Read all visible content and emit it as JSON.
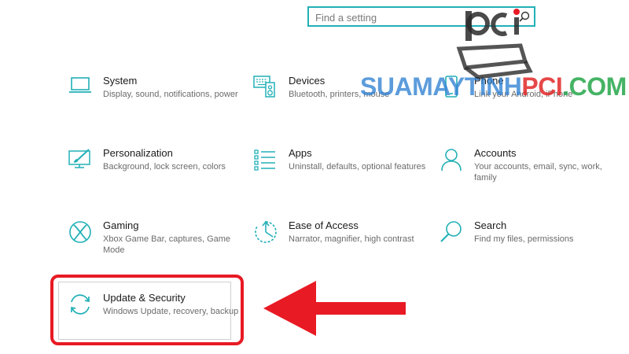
{
  "search": {
    "placeholder": "Find a setting"
  },
  "tiles": [
    {
      "title": "System",
      "desc": "Display, sound, notifications, power",
      "icon": "laptop-icon"
    },
    {
      "title": "Devices",
      "desc": "Bluetooth, printers, mouse",
      "icon": "keyboard-speaker-icon"
    },
    {
      "title": "Phone",
      "desc": "Link your Android, iPhone",
      "icon": "phone-icon"
    },
    {
      "title": "Personalization",
      "desc": "Background, lock screen, colors",
      "icon": "paint-brush-icon"
    },
    {
      "title": "Apps",
      "desc": "Uninstall, defaults, optional features",
      "icon": "apps-list-icon"
    },
    {
      "title": "Accounts",
      "desc": "Your accounts, email, sync, work, family",
      "icon": "person-icon"
    },
    {
      "title": "Gaming",
      "desc": "Xbox Game Bar, captures, Game Mode",
      "icon": "xbox-icon"
    },
    {
      "title": "Ease of Access",
      "desc": "Narrator, magnifier, high contrast",
      "icon": "ease-of-access-icon"
    },
    {
      "title": "Search",
      "desc": "Find my files, permissions",
      "icon": "search-icon"
    },
    {
      "title": "Update & Security",
      "desc": "Windows Update, recovery, backup",
      "icon": "sync-arrows-icon"
    }
  ],
  "watermark": {
    "main": "SUAMAYTINH",
    "pci": "PCI",
    "dot": ".",
    "com": "COM"
  },
  "colors": {
    "accent": "#22b0b7",
    "highlight": "#e81a24"
  }
}
